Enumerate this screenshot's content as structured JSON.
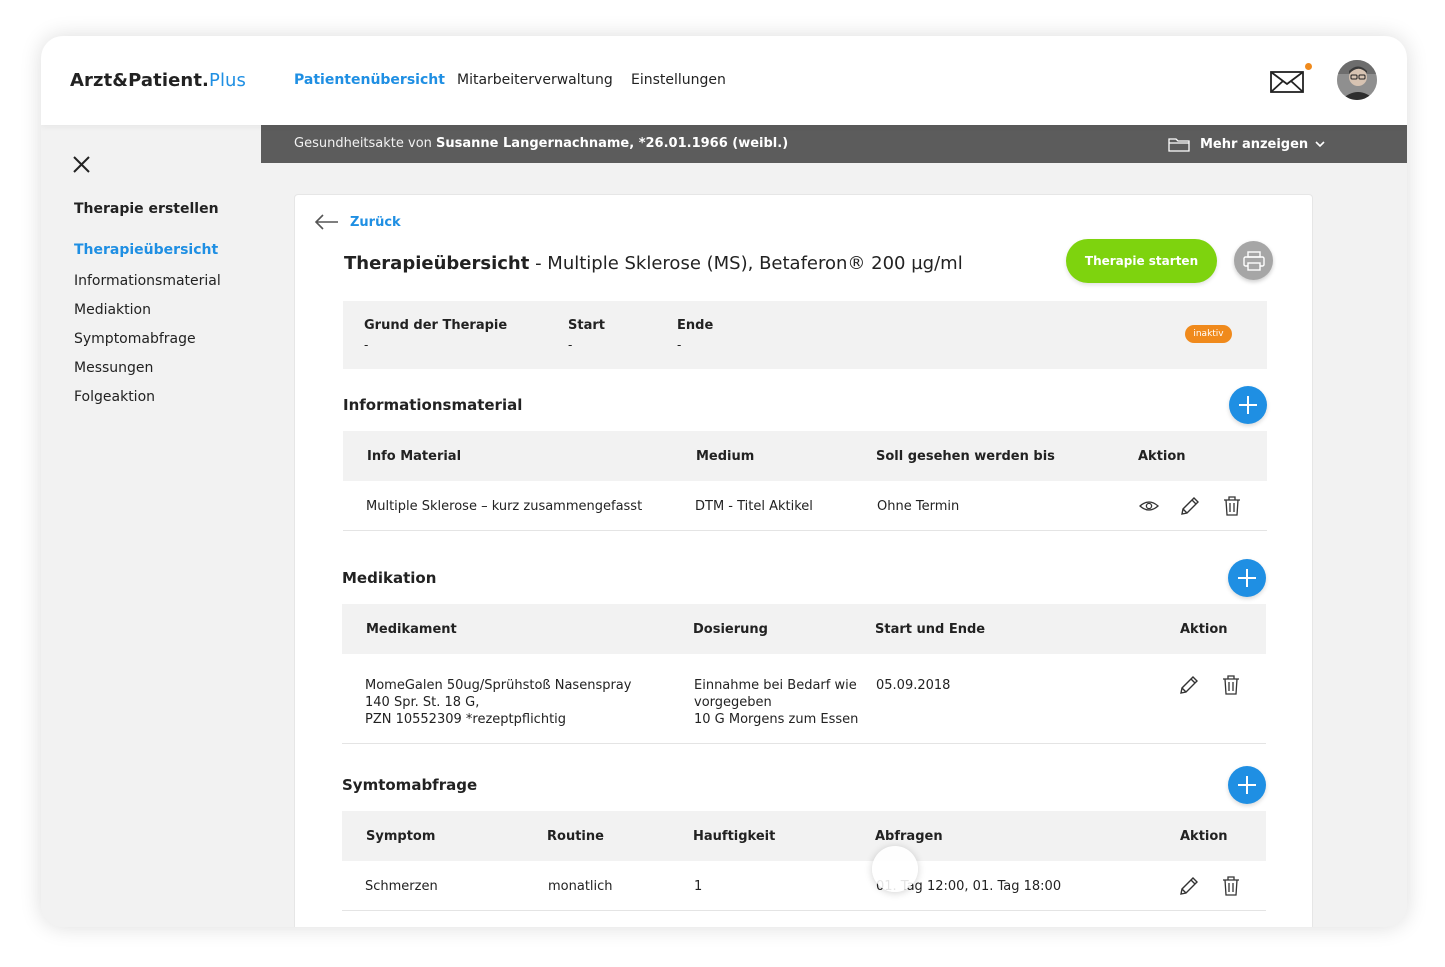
{
  "app": {
    "brand_main": "Arzt&Patient.",
    "brand_plus": "Plus"
  },
  "nav": {
    "items": [
      "Patientenübersicht",
      "Mitarbeiterverwaltung",
      "Einstellungen"
    ]
  },
  "header_icons": {
    "mail": "envelope-icon",
    "notification_color": "#f08a1c",
    "avatar": "user-avatar"
  },
  "sidebar": {
    "title": "Therapie erstellen",
    "items": [
      "Therapieübersicht",
      "Informationsmaterial",
      "Mediaktion",
      "Symptomabfrage",
      "Messungen",
      "Folgeaktion"
    ]
  },
  "record_bar": {
    "prefix": "Gesundheitsakte von",
    "patient": "Susanne Langernachname, *26.01.1966 (weibl.)",
    "more": "Mehr anzeigen"
  },
  "main": {
    "back": "Zurück",
    "title_bold": "Therapieübersicht",
    "title_rest": " - Multiple Sklerose (MS), Betaferon® 200 µg/ml",
    "start_button": "Therapie starten",
    "info": {
      "labels": [
        "Grund der Therapie",
        "Start",
        "Ende"
      ],
      "values": [
        "-",
        "-",
        "-"
      ],
      "status": "inaktiv"
    },
    "sections": {
      "info_material": {
        "title": "Informationsmaterial",
        "headers": [
          "Info Material",
          "Medium",
          "Soll gesehen werden bis",
          "Aktion"
        ],
        "rows": [
          [
            "Multiple Sklerose – kurz zusammengefasst",
            "DTM - Titel Aktikel",
            "Ohne Termin"
          ]
        ]
      },
      "medication": {
        "title": "Medikation",
        "headers": [
          "Medikament",
          "Dosierung",
          "Start und Ende",
          "Aktion"
        ],
        "rows": [
          {
            "drug": [
              "MomeGalen 50ug/Sprühstoß Nasenspray",
              "140 Spr. St. 18 G,",
              "PZN 10552309 *rezeptpflichtig"
            ],
            "dose": [
              "Einnahme bei Bedarf wie",
              "vorgegeben",
              "10 G Morgens zum Essen"
            ],
            "dates": "05.09.2018"
          }
        ]
      },
      "symptom": {
        "title": "Symtomabfrage",
        "headers": [
          "Symptom",
          "Routine",
          "Hauftigkeit",
          "Abfragen",
          "Aktion"
        ],
        "rows": [
          [
            "Schmerzen",
            "monatlich",
            "1",
            "01. Tag 12:00, 01. Tag 18:00"
          ]
        ]
      }
    }
  },
  "colors": {
    "accent": "#1f8fe3",
    "start_green": "#7ed30e",
    "badge_orange": "#f08a1c",
    "record_bar": "#5c5c5c"
  }
}
